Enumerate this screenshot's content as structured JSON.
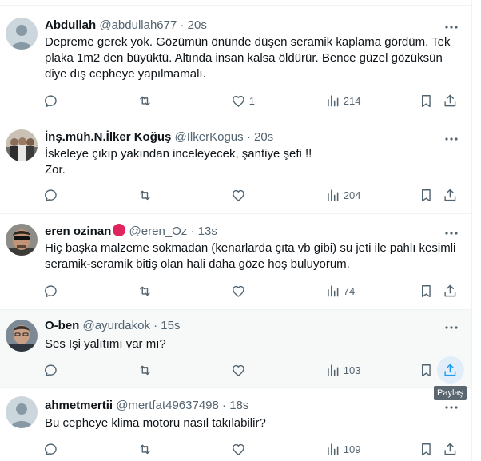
{
  "tweets": [
    {
      "name": "Abdullah",
      "handle": "@abdullah677",
      "sep": "·",
      "time": "20s",
      "text": "Depreme gerek yok. Gözümün önünde düşen seramik kaplama gördüm. Tek plaka 1m2 den büyüktü. Altında insan kalsa öldürür. Bence güzel gözüksün diye dış cepheye yapılmamalı.",
      "likes": "1",
      "views": "214",
      "avatar": "default"
    },
    {
      "name": "İnş.müh.N.İlker Koğuş",
      "handle": "@IlkerKogus",
      "sep": "·",
      "time": "20s",
      "text": "İskeleye çıkıp yakından inceleyecek, şantiye şefi !!\nZor.",
      "likes": "",
      "views": "204",
      "avatar": "group-photo"
    },
    {
      "name": "eren ozinan",
      "handle": "@eren_Oz",
      "sep": "·",
      "time": "13s",
      "text": "Hiç başka malzeme sokmadan (kenarlarda çıta vb gibi) su jeti ile pahlı kesimli seramik-seramik bitiş olan hali daha göze hoş buluyorum.",
      "likes": "",
      "views": "74",
      "avatar": "man-sunglasses-photo"
    },
    {
      "name": "O-ben",
      "handle": "@ayurdakok",
      "sep": "·",
      "time": "15s",
      "text": "Ses Işi yalıtımı var mı?",
      "likes": "",
      "views": "103",
      "avatar": "man-photo"
    },
    {
      "name": "ahmetmertii",
      "handle": "@mertfat49637498",
      "sep": "·",
      "time": "18s",
      "text": "Bu cepheye klima motoru nasıl takılabilir?",
      "likes": "",
      "views": "109",
      "avatar": "default"
    }
  ],
  "tooltip": "Paylaş",
  "icons": [
    "reply-icon",
    "retweet-icon",
    "like-icon",
    "views-icon",
    "bookmark-icon",
    "share-icon",
    "more-icon"
  ],
  "colors": {
    "text": "#0f1419",
    "secondary": "#536471",
    "accent": "#1d9bf0",
    "hover": "#f7f9f9"
  }
}
